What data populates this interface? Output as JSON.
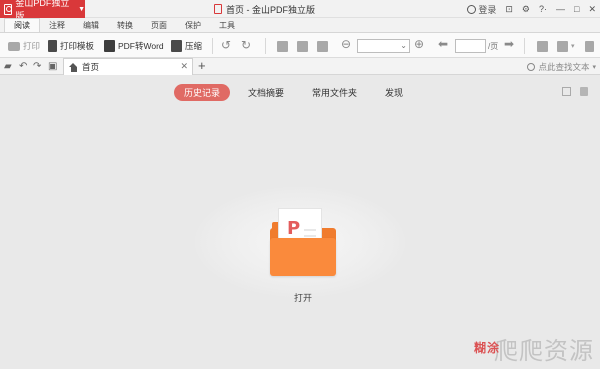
{
  "app": {
    "name": "金山PDF独立版",
    "window_title": "首页 - 金山PDF独立版",
    "login_label": "登录"
  },
  "menu": {
    "tabs": [
      "阅读",
      "注释",
      "编辑",
      "转换",
      "页面",
      "保护",
      "工具"
    ],
    "active": "阅读"
  },
  "toolbar": {
    "print": "打印",
    "print_template": "打印模板",
    "pdf_to_word": "PDF转Word",
    "compress": "压缩",
    "page_suffix": "/页"
  },
  "doc_tabs": {
    "home_tab_label": "首页",
    "search_placeholder": "点此查找文本"
  },
  "home": {
    "tabs": [
      "历史记录",
      "文档摘要",
      "常用文件夹",
      "发现"
    ],
    "active_tab": "历史记录",
    "open_label": "打开"
  },
  "watermark": {
    "text": "爬爬资源",
    "overlay": "糊涂"
  },
  "colors": {
    "brand_red": "#d9383a",
    "active_tab_bg": "#e06a64",
    "folder_orange": "#f07c2e"
  }
}
